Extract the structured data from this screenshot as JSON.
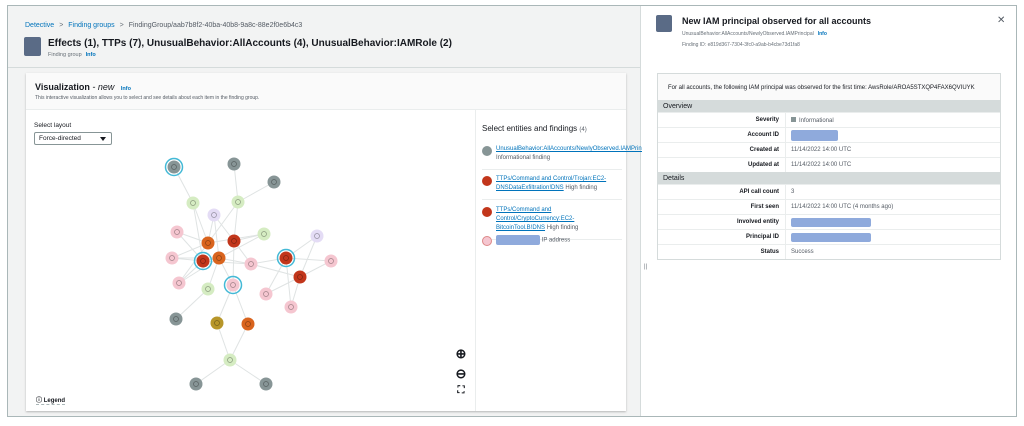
{
  "breadcrumb": [
    "Detective",
    "Finding groups",
    "FindingGroup/aab7b8f2-40ba-40b8-9a8c-88e2f0e6b4c3"
  ],
  "header": {
    "title": "Effects (1), TTPs (7), UnusualBehavior:AllAccounts (4), UnusualBehavior:IAMRole (2)",
    "subtitle": "Finding group",
    "info": "Info"
  },
  "viz": {
    "title": "Visualization",
    "title_suffix": "- new",
    "info": "Info",
    "description": "This interactive visualization allows you to select and see details about each item in the finding group.",
    "layout_label": "Select layout",
    "layout_value": "Force-directed",
    "legend": "Legend"
  },
  "entities": {
    "title": "Select entities and findings",
    "count": "(4)",
    "items": [
      {
        "link": "UnusualBehavior:AllAccounts/NewlyObserved.IAMPrincipal",
        "kind": "Informational finding",
        "color": "#879596"
      },
      {
        "link": "TTPs/Command and Control/Trojan:EC2-DNSDataExfiltration!DNS",
        "kind": "High finding",
        "color": "#c2361b"
      },
      {
        "link": "TTPs/Command and Control/CryptoCurrency:EC2-BitcoinTool.B!DNS",
        "kind": "High finding",
        "color": "#c2361b"
      },
      {
        "link": "",
        "kind": "IP address",
        "color": "#f5c6d0"
      }
    ]
  },
  "detail": {
    "title": "New IAM principal observed for all accounts",
    "type": "UnusualBehavior:AllAccounts/NewlyObserved.IAMPrincipal",
    "info": "Info",
    "finding_id_label": "Finding ID:",
    "finding_id": "e819d367-7304-3fc0-a9ab-b4cbe73d1fa8",
    "description": "For all accounts, the following IAM principal was observed for the first time: AwsRole/AROA5STXQP4FAX6QVIUYK",
    "overview_title": "Overview",
    "overview": [
      {
        "k": "Severity",
        "v": "Informational"
      },
      {
        "k": "Account ID",
        "v": null
      },
      {
        "k": "Created at",
        "v": "11/14/2022 14:00 UTC"
      },
      {
        "k": "Updated at",
        "v": "11/14/2022 14:00 UTC"
      }
    ],
    "details_title": "Details",
    "details": [
      {
        "k": "API call count",
        "v": "3"
      },
      {
        "k": "First seen",
        "v": "11/14/2022 14:00 UTC (4 months ago)"
      },
      {
        "k": "Involved entity",
        "v": null
      },
      {
        "k": "Principal ID",
        "v": null
      },
      {
        "k": "Status",
        "v": "Success"
      }
    ]
  },
  "colors": {
    "gray": "#879596",
    "green": "#d5ecc2",
    "purple": "#e4dcf5",
    "pink": "#f5c6d0",
    "orange": "#d9641e",
    "red": "#c2361b",
    "olive": "#b7962a",
    "highlight": "#44b9d6",
    "link": "#0073bb"
  }
}
